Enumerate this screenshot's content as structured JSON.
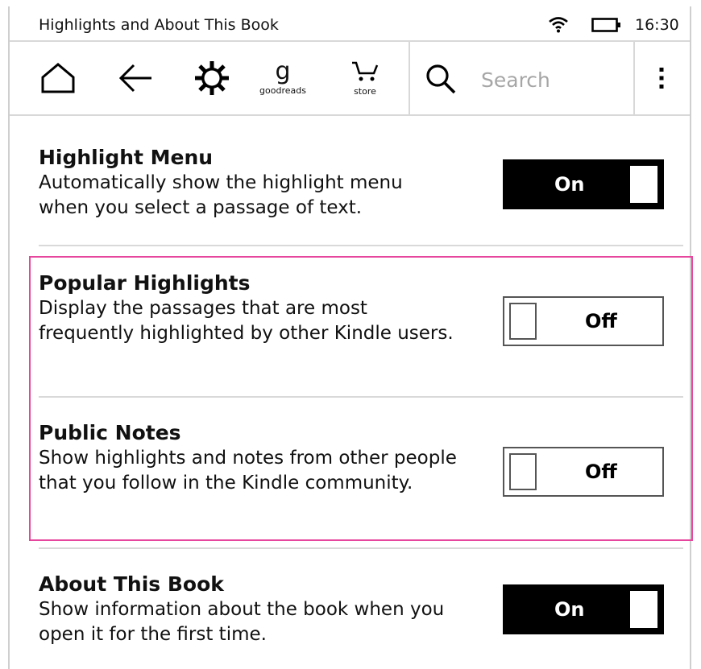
{
  "status_bar": {
    "title": "Highlights and About This Book",
    "wifi_icon": "wifi-icon",
    "battery_icon": "battery-icon",
    "time": "16:30"
  },
  "toolbar": {
    "home_icon": "home-icon",
    "back_icon": "back-arrow-icon",
    "settings_icon": "gear-icon",
    "goodreads": {
      "glyph": "g",
      "label": "goodreads"
    },
    "store": {
      "icon": "cart-icon",
      "label": "store"
    },
    "search": {
      "icon": "search-icon",
      "placeholder": "Search"
    },
    "menu_icon": "more-vertical-icon"
  },
  "settings": [
    {
      "title": "Highlight Menu",
      "description": "Automatically show the highlight menu when you select a passage of text.",
      "state": "On"
    },
    {
      "title": "Popular Highlights",
      "description": "Display the passages that are most frequently highlighted by other Kindle users.",
      "state": "Off"
    },
    {
      "title": "Public Notes",
      "description": "Show highlights and notes from other people that you follow in the Kindle community.",
      "state": "Off"
    },
    {
      "title": "About This Book",
      "description": "Show information about the book when you open it for the first time.",
      "state": "On"
    }
  ],
  "colors": {
    "highlight_border": "#e6469e",
    "toggle_on_bg": "#000000",
    "divider": "#d9d9d9"
  }
}
